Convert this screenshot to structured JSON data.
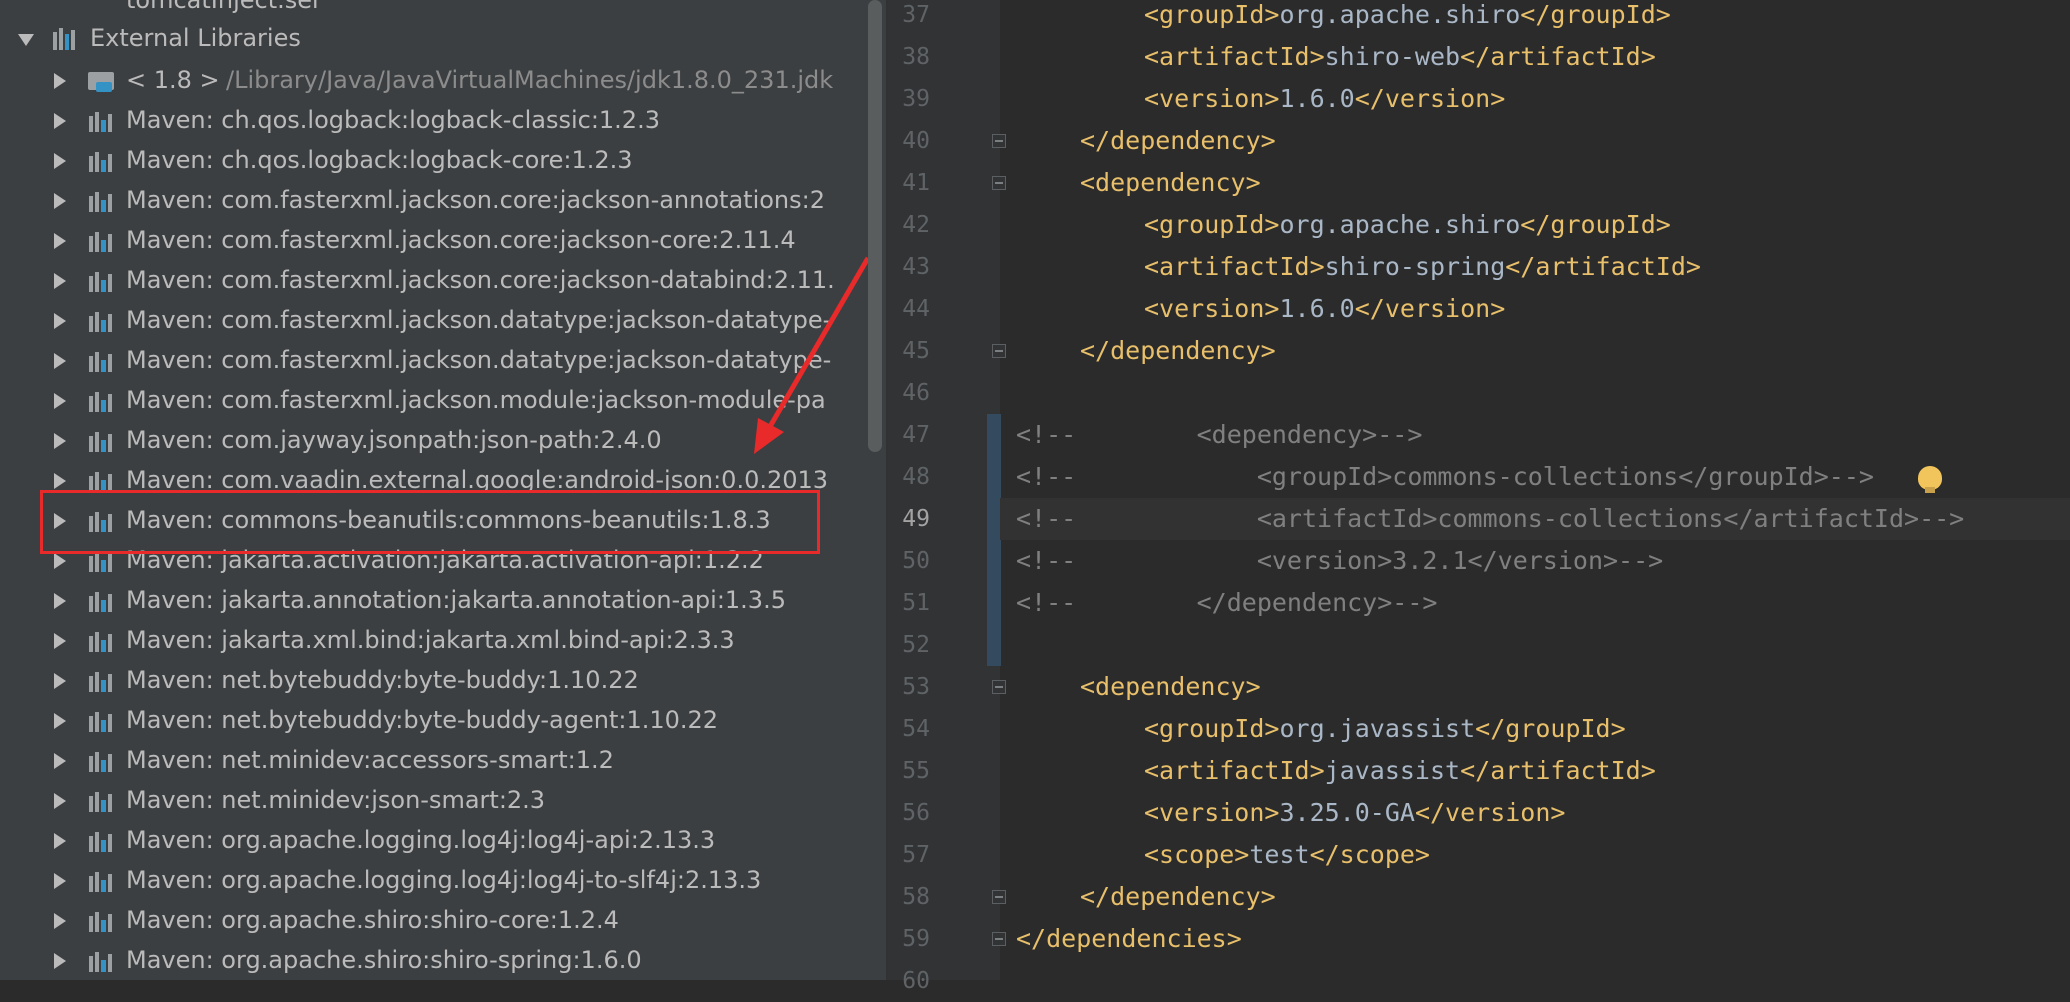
{
  "tree": {
    "top_cut": "tomcatInject.ser",
    "section": "External Libraries",
    "rows": [
      {
        "name": "< 1.8 >",
        "path": "/Library/Java/JavaVirtualMachines/jdk1.8.0_231.jdk"
      },
      {
        "name": "Maven: ch.qos.logback:logback-classic:1.2.3"
      },
      {
        "name": "Maven: ch.qos.logback:logback-core:1.2.3"
      },
      {
        "name": "Maven: com.fasterxml.jackson.core:jackson-annotations:2"
      },
      {
        "name": "Maven: com.fasterxml.jackson.core:jackson-core:2.11.4"
      },
      {
        "name": "Maven: com.fasterxml.jackson.core:jackson-databind:2.11."
      },
      {
        "name": "Maven: com.fasterxml.jackson.datatype:jackson-datatype-"
      },
      {
        "name": "Maven: com.fasterxml.jackson.datatype:jackson-datatype-"
      },
      {
        "name": "Maven: com.fasterxml.jackson.module:jackson-module-pa"
      },
      {
        "name": "Maven: com.jayway.jsonpath:json-path:2.4.0"
      },
      {
        "name": "Maven: com.vaadin.external.google:android-json:0.0.2013"
      },
      {
        "name": "Maven: commons-beanutils:commons-beanutils:1.8.3"
      },
      {
        "name": "Maven: jakarta.activation:jakarta.activation-api:1.2.2"
      },
      {
        "name": "Maven: jakarta.annotation:jakarta.annotation-api:1.3.5"
      },
      {
        "name": "Maven: jakarta.xml.bind:jakarta.xml.bind-api:2.3.3"
      },
      {
        "name": "Maven: net.bytebuddy:byte-buddy:1.10.22"
      },
      {
        "name": "Maven: net.bytebuddy:byte-buddy-agent:1.10.22"
      },
      {
        "name": "Maven: net.minidev:accessors-smart:1.2"
      },
      {
        "name": "Maven: net.minidev:json-smart:2.3"
      },
      {
        "name": "Maven: org.apache.logging.log4j:log4j-api:2.13.3"
      },
      {
        "name": "Maven: org.apache.logging.log4j:log4j-to-slf4j:2.13.3"
      },
      {
        "name": "Maven: org.apache.shiro:shiro-core:1.2.4"
      },
      {
        "name": "Maven: org.apache.shiro:shiro-spring:1.6.0"
      }
    ]
  },
  "editor": {
    "current_line": "49",
    "lines": [
      {
        "no": "37",
        "text": "<groupId>org.apache.shiro</groupId>"
      },
      {
        "no": "38",
        "text": "<artifactId>shiro-web</artifactId>"
      },
      {
        "no": "39",
        "text": "<version>1.6.0</version>"
      },
      {
        "no": "40",
        "text": "</dependency>"
      },
      {
        "no": "41",
        "text": "<dependency>"
      },
      {
        "no": "42",
        "text": "<groupId>org.apache.shiro</groupId>"
      },
      {
        "no": "43",
        "text": "<artifactId>shiro-spring</artifactId>"
      },
      {
        "no": "44",
        "text": "<version>1.6.0</version>"
      },
      {
        "no": "45",
        "text": "</dependency>"
      },
      {
        "no": "46",
        "text": ""
      },
      {
        "no": "47",
        "text": "<!--        <dependency>-->"
      },
      {
        "no": "48",
        "text": "<!--            <groupId>commons-collections</groupId>-->"
      },
      {
        "no": "49",
        "text": "<!--            <artifactId>commons-collections</artifactId>-->"
      },
      {
        "no": "50",
        "text": "<!--            <version>3.2.1</version>-->"
      },
      {
        "no": "51",
        "text": "<!--        </dependency>-->"
      },
      {
        "no": "52",
        "text": ""
      },
      {
        "no": "53",
        "text": "<dependency>"
      },
      {
        "no": "54",
        "text": "<groupId>org.javassist</groupId>"
      },
      {
        "no": "55",
        "text": "<artifactId>javassist</artifactId>"
      },
      {
        "no": "56",
        "text": "<version>3.25.0-GA</version>"
      },
      {
        "no": "57",
        "text": "<scope>test</scope>"
      },
      {
        "no": "58",
        "text": "</dependency>"
      },
      {
        "no": "59",
        "text": "</dependencies>"
      },
      {
        "no": "60",
        "text": ""
      }
    ]
  },
  "colors": {
    "tag": "#e8bf6a",
    "text": "#a9b7c6",
    "comment": "#808080",
    "highlight": "#e82a2a"
  },
  "icons": {
    "expand": "chevron-right-icon",
    "collapse": "chevron-down-icon",
    "library": "library-icon",
    "intention": "lightbulb-icon"
  }
}
